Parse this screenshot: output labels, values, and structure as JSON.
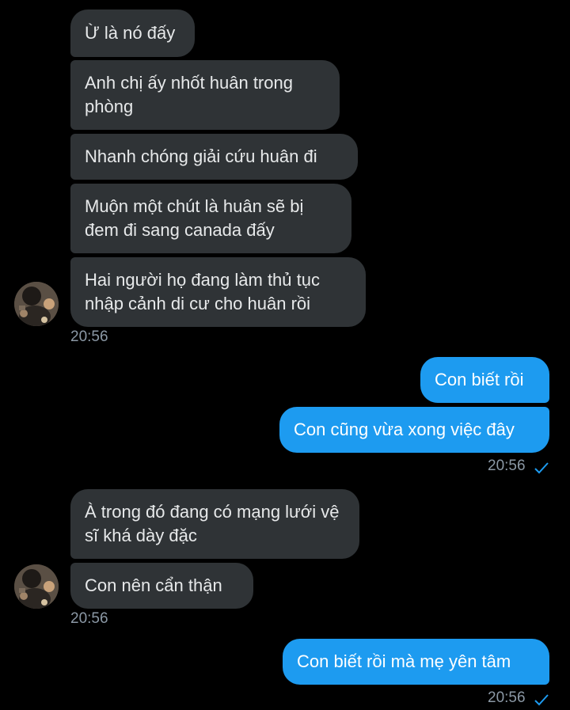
{
  "colors": {
    "background": "#000000",
    "incoming_bubble": "#2f3336",
    "outgoing_bubble": "#1d9bf0",
    "timestamp": "#8b98a5",
    "read_check": "#1d9bf0"
  },
  "messages": {
    "m1": "Ừ là nó đấy",
    "m2": "Anh chị ấy nhốt huân trong phòng",
    "m3": "Nhanh chóng giải cứu huân đi",
    "m4": "Muộn một chút là huân sẽ bị đem đi sang canada đấy",
    "m5": "Hai người họ đang làm thủ tục nhập cảnh di cư cho huân rồi",
    "m6": "Con biết rồi",
    "m7": "Con cũng vừa xong việc đây",
    "m8": "À trong đó đang có mạng lưới vệ sĩ khá dày đặc",
    "m9": "Con nên cẩn thận",
    "m10": "Con biết rồi mà mẹ yên tâm"
  },
  "timestamps": {
    "t1": "20:56",
    "t2": "20:56",
    "t3": "20:56",
    "t4": "20:56"
  },
  "icons": {
    "avatar": "contact-avatar",
    "check": "checkmark-icon"
  }
}
